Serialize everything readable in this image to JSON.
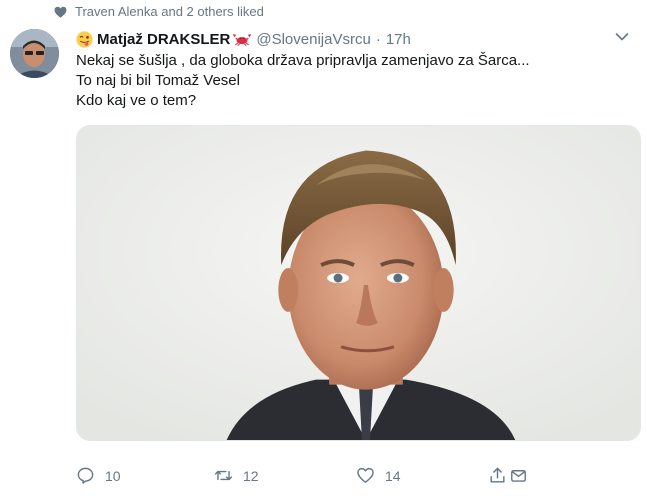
{
  "social_context": {
    "text": "Traven Alenka and 2 others liked",
    "icon": "heart-icon"
  },
  "tweet": {
    "author": {
      "name": "Matjaž DRAKSLER",
      "handle": "@SlovenijaVsrcu",
      "emoji_prefix": "winking-face-tongue",
      "emoji_suffix": "crab"
    },
    "separator": "·",
    "time": "17h",
    "text_lines": [
      "Nekaj se šušlja , da globoka država pripravlja zamenjavo za Šarca...",
      "To naj bi bil Tomaž Vesel",
      "Kdo kaj ve o tem?"
    ],
    "media": {
      "type": "photo"
    },
    "actions": {
      "reply": {
        "icon": "reply-icon",
        "count": "10"
      },
      "retweet": {
        "icon": "retweet-icon",
        "count": "12"
      },
      "like": {
        "icon": "like-icon",
        "count": "14"
      },
      "share": {
        "icon": "share-icon"
      }
    }
  },
  "colors": {
    "secondary_text": "#657786",
    "primary_text": "#14171a",
    "border": "#e1e8ed"
  }
}
